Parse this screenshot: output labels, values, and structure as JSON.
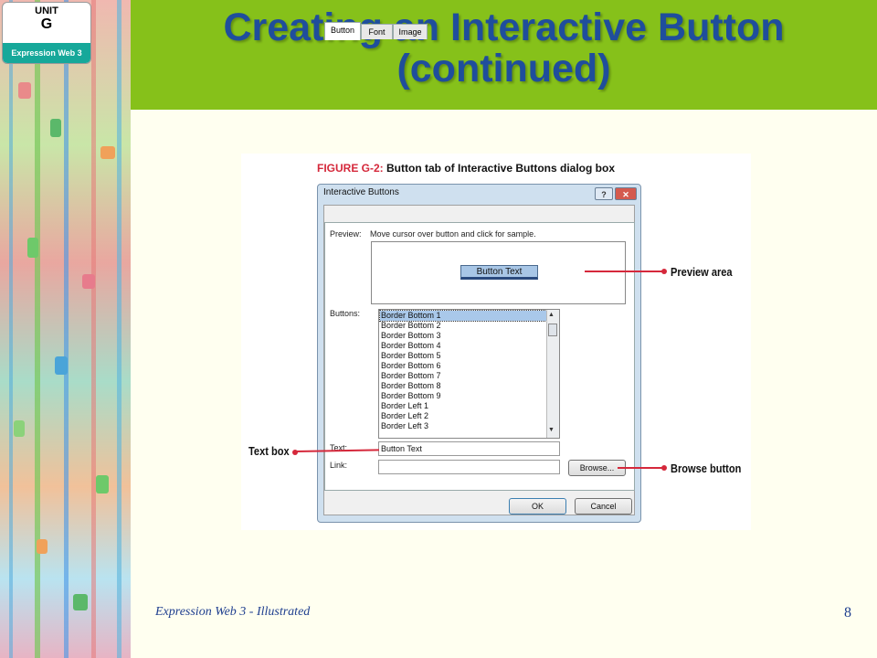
{
  "badge": {
    "unit_label": "UNIT",
    "unit_letter": "G",
    "course": "Expression Web 3"
  },
  "slide": {
    "title_line1": "Creating an Interactive Button",
    "title_line2": "(continued)"
  },
  "figure": {
    "caption_number": "FIGURE G-2:",
    "caption_text": " Button tab of Interactive Buttons dialog box",
    "dialog": {
      "title": "Interactive Buttons",
      "help_glyph": "?",
      "close_glyph": "✕",
      "tabs": [
        "Button",
        "Font",
        "Image"
      ],
      "active_tab": "Button",
      "preview_label": "Preview:",
      "preview_hint": "Move cursor over button and click for sample.",
      "preview_button_text": "Button Text",
      "buttons_label": "Buttons:",
      "buttons_list": [
        "Border Bottom 1",
        "Border Bottom 2",
        "Border Bottom 3",
        "Border Bottom 4",
        "Border Bottom 5",
        "Border Bottom 6",
        "Border Bottom 7",
        "Border Bottom 8",
        "Border Bottom 9",
        "Border Left 1",
        "Border Left 2",
        "Border Left 3"
      ],
      "selected_button": "Border Bottom 1",
      "text_label": "Text:",
      "text_value": "Button Text",
      "link_label": "Link:",
      "link_value": "",
      "browse_label": "Browse...",
      "ok_label": "OK",
      "cancel_label": "Cancel"
    },
    "callouts": {
      "preview_area": "Preview area",
      "text_box": "Text box",
      "browse_button": "Browse button"
    }
  },
  "footer": {
    "text": "Expression Web 3 - Illustrated",
    "page_number": "8"
  },
  "colors": {
    "header_green": "#86c11a",
    "title_blue": "#1f4e9c",
    "callout_red": "#d5283b",
    "badge_teal": "#16a89a"
  }
}
